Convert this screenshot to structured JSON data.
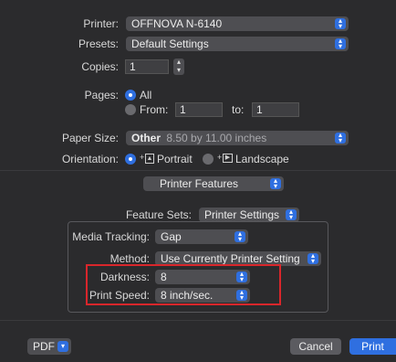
{
  "printer": {
    "label": "Printer:",
    "value": "OFFNOVA N-6140"
  },
  "presets": {
    "label": "Presets:",
    "value": "Default Settings"
  },
  "copies": {
    "label": "Copies:",
    "value": "1"
  },
  "pages": {
    "label": "Pages:",
    "all_label": "All",
    "from_label": "From:",
    "from_value": "1",
    "to_label": "to:",
    "to_value": "1",
    "selected": "All"
  },
  "paper_size": {
    "label": "Paper Size:",
    "value": "Other",
    "detail": "8.50 by 11.00 inches"
  },
  "orientation": {
    "label": "Orientation:",
    "portrait_label": "Portrait",
    "landscape_label": "Landscape",
    "selected": "Portrait"
  },
  "section_popup": {
    "value": "Printer Features"
  },
  "feature_sets": {
    "label": "Feature Sets:",
    "value": "Printer Settings"
  },
  "media_tracking": {
    "label": "Media Tracking:",
    "value": "Gap"
  },
  "method": {
    "label": "Method:",
    "value": "Use Currently Printer Setting"
  },
  "darkness": {
    "label": "Darkness:",
    "value": "8"
  },
  "print_speed": {
    "label": "Print Speed:",
    "value": "8 inch/sec."
  },
  "footer": {
    "pdf_label": "PDF",
    "cancel_label": "Cancel",
    "print_label": "Print"
  },
  "colors": {
    "accent": "#2f6fe0",
    "highlight_box": "#d9262b",
    "background": "#2b2b2d"
  }
}
